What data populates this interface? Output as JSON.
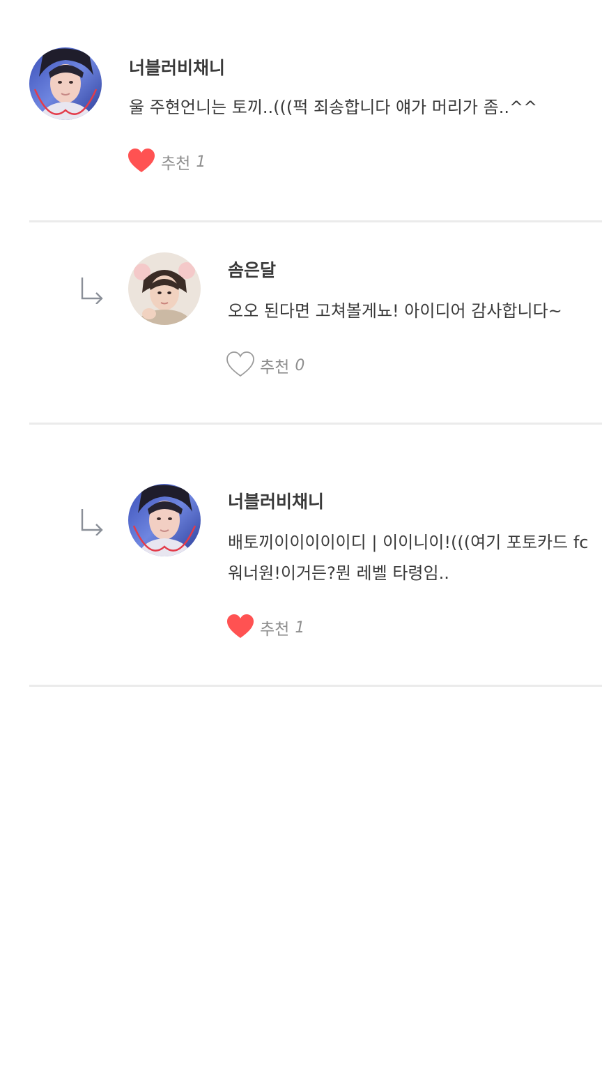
{
  "colors": {
    "heart_filled": "#ff5252",
    "heart_outline": "#9a9a9a",
    "divider": "#ebebeb",
    "text": "#3a3a3a",
    "muted": "#8e8e8e"
  },
  "comments": [
    {
      "author": "너블러비채니",
      "lines": [
        "울 주현언니는 토끼..(((퍽 죄송합니다 얘가 머리가 좀..^^"
      ],
      "like_label": "추천",
      "like_count": "1",
      "liked": true,
      "icon": "heart-filled-icon"
    },
    {
      "author": "솜은달",
      "lines": [
        "오오 된다면 고쳐볼게뇨! 아이디어 감사합니다~"
      ],
      "like_label": "추천",
      "like_count": "0",
      "liked": false,
      "icon": "heart-outline-icon",
      "is_reply": true
    },
    {
      "author": "너블러비채니",
      "lines": [
        "배토끼이이이이이디 | 이이니이!(((여기 포토카드 fc",
        "워너원!이거든?뭔 레벨 타령임.."
      ],
      "like_label": "추천",
      "like_count": "1",
      "liked": true,
      "icon": "heart-filled-icon",
      "is_reply": true
    }
  ]
}
